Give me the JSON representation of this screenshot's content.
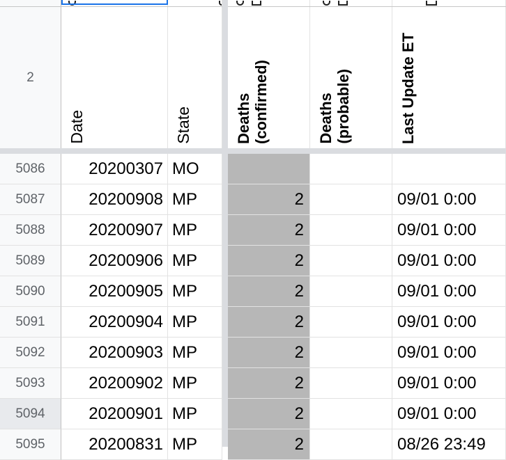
{
  "header_row": {
    "row_number": "2",
    "columns": [
      {
        "label": "Date",
        "bold": false
      },
      {
        "label": "State",
        "bold": false
      },
      {
        "label": "Deaths\n(confirmed)",
        "bold": true
      },
      {
        "label": "Deaths\n(probable)",
        "bold": true
      },
      {
        "label": "Last Update ET",
        "bold": true
      }
    ]
  },
  "rows": [
    {
      "row_number": "5086",
      "date": "20200307",
      "state": "MO",
      "deaths_confirmed": "",
      "deaths_probable": "",
      "last_update": ""
    },
    {
      "row_number": "5087",
      "date": "20200908",
      "state": "MP",
      "deaths_confirmed": "2",
      "deaths_probable": "",
      "last_update": "09/01 0:00"
    },
    {
      "row_number": "5088",
      "date": "20200907",
      "state": "MP",
      "deaths_confirmed": "2",
      "deaths_probable": "",
      "last_update": "09/01 0:00"
    },
    {
      "row_number": "5089",
      "date": "20200906",
      "state": "MP",
      "deaths_confirmed": "2",
      "deaths_probable": "",
      "last_update": "09/01 0:00"
    },
    {
      "row_number": "5090",
      "date": "20200905",
      "state": "MP",
      "deaths_confirmed": "2",
      "deaths_probable": "",
      "last_update": "09/01 0:00"
    },
    {
      "row_number": "5091",
      "date": "20200904",
      "state": "MP",
      "deaths_confirmed": "2",
      "deaths_probable": "",
      "last_update": "09/01 0:00"
    },
    {
      "row_number": "5092",
      "date": "20200903",
      "state": "MP",
      "deaths_confirmed": "2",
      "deaths_probable": "",
      "last_update": "09/01 0:00"
    },
    {
      "row_number": "5093",
      "date": "20200902",
      "state": "MP",
      "deaths_confirmed": "2",
      "deaths_probable": "",
      "last_update": "09/01 0:00"
    },
    {
      "row_number": "5094",
      "date": "20200901",
      "state": "MP",
      "deaths_confirmed": "2",
      "deaths_probable": "",
      "last_update": "09/01 0:00"
    },
    {
      "row_number": "5095",
      "date": "20200831",
      "state": "MP",
      "deaths_confirmed": "2",
      "deaths_probable": "",
      "last_update": "08/26 23:49"
    }
  ],
  "active_row_number": "5094",
  "colors": {
    "selection_border": "#1a73e8",
    "highlight_fill": "#b7b7b7",
    "freeze_bar": "#dadce0",
    "row_header_bg": "#f8f9fa"
  }
}
